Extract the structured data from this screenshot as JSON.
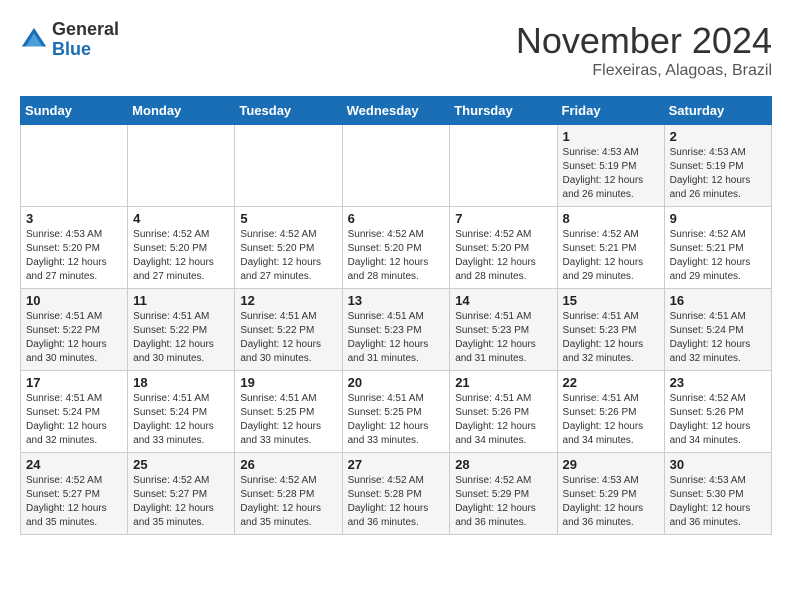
{
  "logo": {
    "general": "General",
    "blue": "Blue"
  },
  "header": {
    "month": "November 2024",
    "location": "Flexeiras, Alagoas, Brazil"
  },
  "weekdays": [
    "Sunday",
    "Monday",
    "Tuesday",
    "Wednesday",
    "Thursday",
    "Friday",
    "Saturday"
  ],
  "weeks": [
    [
      {
        "day": "",
        "info": ""
      },
      {
        "day": "",
        "info": ""
      },
      {
        "day": "",
        "info": ""
      },
      {
        "day": "",
        "info": ""
      },
      {
        "day": "",
        "info": ""
      },
      {
        "day": "1",
        "info": "Sunrise: 4:53 AM\nSunset: 5:19 PM\nDaylight: 12 hours and 26 minutes."
      },
      {
        "day": "2",
        "info": "Sunrise: 4:53 AM\nSunset: 5:19 PM\nDaylight: 12 hours and 26 minutes."
      }
    ],
    [
      {
        "day": "3",
        "info": "Sunrise: 4:53 AM\nSunset: 5:20 PM\nDaylight: 12 hours and 27 minutes."
      },
      {
        "day": "4",
        "info": "Sunrise: 4:52 AM\nSunset: 5:20 PM\nDaylight: 12 hours and 27 minutes."
      },
      {
        "day": "5",
        "info": "Sunrise: 4:52 AM\nSunset: 5:20 PM\nDaylight: 12 hours and 27 minutes."
      },
      {
        "day": "6",
        "info": "Sunrise: 4:52 AM\nSunset: 5:20 PM\nDaylight: 12 hours and 28 minutes."
      },
      {
        "day": "7",
        "info": "Sunrise: 4:52 AM\nSunset: 5:20 PM\nDaylight: 12 hours and 28 minutes."
      },
      {
        "day": "8",
        "info": "Sunrise: 4:52 AM\nSunset: 5:21 PM\nDaylight: 12 hours and 29 minutes."
      },
      {
        "day": "9",
        "info": "Sunrise: 4:52 AM\nSunset: 5:21 PM\nDaylight: 12 hours and 29 minutes."
      }
    ],
    [
      {
        "day": "10",
        "info": "Sunrise: 4:51 AM\nSunset: 5:22 PM\nDaylight: 12 hours and 30 minutes."
      },
      {
        "day": "11",
        "info": "Sunrise: 4:51 AM\nSunset: 5:22 PM\nDaylight: 12 hours and 30 minutes."
      },
      {
        "day": "12",
        "info": "Sunrise: 4:51 AM\nSunset: 5:22 PM\nDaylight: 12 hours and 30 minutes."
      },
      {
        "day": "13",
        "info": "Sunrise: 4:51 AM\nSunset: 5:23 PM\nDaylight: 12 hours and 31 minutes."
      },
      {
        "day": "14",
        "info": "Sunrise: 4:51 AM\nSunset: 5:23 PM\nDaylight: 12 hours and 31 minutes."
      },
      {
        "day": "15",
        "info": "Sunrise: 4:51 AM\nSunset: 5:23 PM\nDaylight: 12 hours and 32 minutes."
      },
      {
        "day": "16",
        "info": "Sunrise: 4:51 AM\nSunset: 5:24 PM\nDaylight: 12 hours and 32 minutes."
      }
    ],
    [
      {
        "day": "17",
        "info": "Sunrise: 4:51 AM\nSunset: 5:24 PM\nDaylight: 12 hours and 32 minutes."
      },
      {
        "day": "18",
        "info": "Sunrise: 4:51 AM\nSunset: 5:24 PM\nDaylight: 12 hours and 33 minutes."
      },
      {
        "day": "19",
        "info": "Sunrise: 4:51 AM\nSunset: 5:25 PM\nDaylight: 12 hours and 33 minutes."
      },
      {
        "day": "20",
        "info": "Sunrise: 4:51 AM\nSunset: 5:25 PM\nDaylight: 12 hours and 33 minutes."
      },
      {
        "day": "21",
        "info": "Sunrise: 4:51 AM\nSunset: 5:26 PM\nDaylight: 12 hours and 34 minutes."
      },
      {
        "day": "22",
        "info": "Sunrise: 4:51 AM\nSunset: 5:26 PM\nDaylight: 12 hours and 34 minutes."
      },
      {
        "day": "23",
        "info": "Sunrise: 4:52 AM\nSunset: 5:26 PM\nDaylight: 12 hours and 34 minutes."
      }
    ],
    [
      {
        "day": "24",
        "info": "Sunrise: 4:52 AM\nSunset: 5:27 PM\nDaylight: 12 hours and 35 minutes."
      },
      {
        "day": "25",
        "info": "Sunrise: 4:52 AM\nSunset: 5:27 PM\nDaylight: 12 hours and 35 minutes."
      },
      {
        "day": "26",
        "info": "Sunrise: 4:52 AM\nSunset: 5:28 PM\nDaylight: 12 hours and 35 minutes."
      },
      {
        "day": "27",
        "info": "Sunrise: 4:52 AM\nSunset: 5:28 PM\nDaylight: 12 hours and 36 minutes."
      },
      {
        "day": "28",
        "info": "Sunrise: 4:52 AM\nSunset: 5:29 PM\nDaylight: 12 hours and 36 minutes."
      },
      {
        "day": "29",
        "info": "Sunrise: 4:53 AM\nSunset: 5:29 PM\nDaylight: 12 hours and 36 minutes."
      },
      {
        "day": "30",
        "info": "Sunrise: 4:53 AM\nSunset: 5:30 PM\nDaylight: 12 hours and 36 minutes."
      }
    ]
  ]
}
